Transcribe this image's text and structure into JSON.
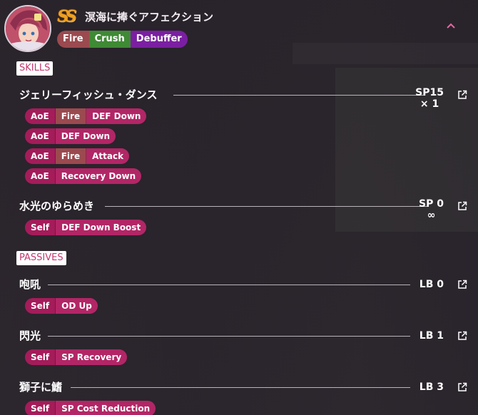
{
  "header": {
    "rank": "SS",
    "title": "溟海に捧ぐアフェクション",
    "tags": [
      {
        "label": "Fire",
        "color": "#9b4a4f"
      },
      {
        "label": "Crush",
        "color": "#3f8a34"
      },
      {
        "label": "Debuffer",
        "color": "#7b1fa2"
      }
    ],
    "collapse_icon": "chevron-up-icon"
  },
  "sections": {
    "skills": "SKILLS",
    "passives": "PASSIVES"
  },
  "skills": [
    {
      "name": "ジェリーフィッシュ・ダンス",
      "cost": "SP15",
      "uses": "× 1",
      "effects": [
        [
          "AoE",
          "Fire",
          "DEF Down"
        ],
        [
          "AoE",
          "DEF Down"
        ],
        [
          "AoE",
          "Fire",
          "Attack"
        ],
        [
          "AoE",
          "Recovery Down"
        ]
      ]
    },
    {
      "name": "水光のゆらめき",
      "cost": "SP 0",
      "uses": "∞",
      "effects": [
        [
          "Self",
          "DEF Down Boost"
        ]
      ]
    }
  ],
  "passives": [
    {
      "name": "咆吼",
      "cost": "LB 0",
      "effects": [
        [
          "Self",
          "OD Up"
        ]
      ]
    },
    {
      "name": "閃光",
      "cost": "LB 1",
      "effects": [
        [
          "Self",
          "SP Recovery"
        ]
      ]
    },
    {
      "name": "獅子に鰭",
      "cost": "LB 3",
      "effects": [
        [
          "Self",
          "SP Cost Reduction"
        ]
      ]
    }
  ]
}
